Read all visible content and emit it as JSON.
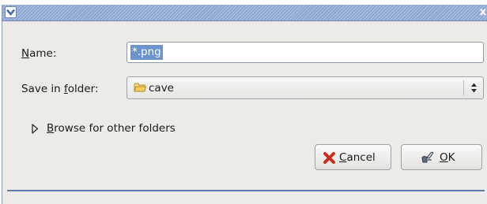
{
  "titlebar": {
    "title": "",
    "close_glyph": "x"
  },
  "name_field": {
    "label_mnemonic": "N",
    "label_rest": "ame:",
    "value": "*.png"
  },
  "folder_field": {
    "label_prefix": "Save in ",
    "label_mnemonic": "f",
    "label_rest": "older:",
    "selected": "cave"
  },
  "browse": {
    "mnemonic": "B",
    "rest": "rowse for other folders"
  },
  "buttons": {
    "cancel": {
      "mnemonic": "C",
      "rest": "ancel"
    },
    "ok": {
      "mnemonic": "O",
      "rest": "K"
    }
  },
  "icons": {
    "window_menu": "chevron-down-icon",
    "close": "close-icon",
    "folder": "folder-icon",
    "combo_arrows": "updown-arrows-icon",
    "expander": "triangle-right-icon",
    "cancel": "red-x-icon",
    "ok": "ok-icon"
  },
  "colors": {
    "titlebar": "#8ea8d2",
    "selection": "#6b93cc",
    "dialog_bg": "#ecebe8",
    "cancel_icon": "#cc2b1d"
  }
}
